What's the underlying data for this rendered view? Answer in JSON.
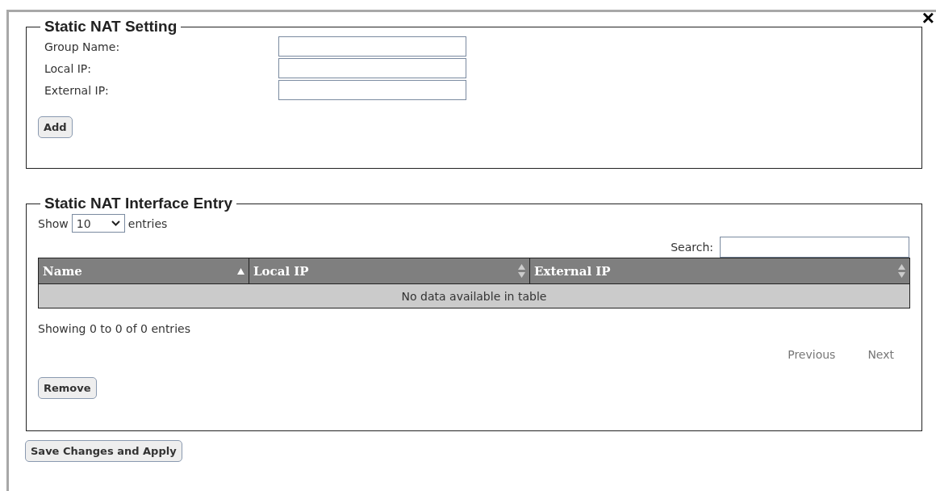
{
  "close": "×",
  "setting": {
    "legend": "Static NAT Setting",
    "fields": [
      {
        "label": "Group Name:"
      },
      {
        "label": "Local IP:"
      },
      {
        "label": "External IP:"
      }
    ],
    "add_button": "Add"
  },
  "entries": {
    "legend": "Static NAT Interface Entry",
    "show_label": "Show",
    "page_size": "10",
    "entries_label": "entries",
    "search_label": "Search:",
    "columns": [
      {
        "label": "Name",
        "sorted": true
      },
      {
        "label": "Local IP",
        "sorted": false
      },
      {
        "label": "External IP",
        "sorted": false
      }
    ],
    "empty_message": "No data available in table",
    "info": "Showing 0 to 0 of 0 entries",
    "pager": [
      {
        "label": "Previous",
        "disabled": true
      },
      {
        "label": "Next",
        "disabled": true
      }
    ],
    "remove_button": "Remove"
  },
  "save_button": "Save Changes and Apply"
}
